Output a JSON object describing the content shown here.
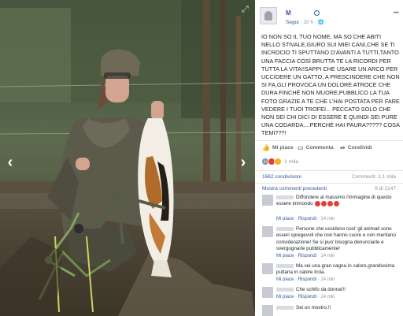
{
  "post": {
    "author": "M",
    "follow": "Segui",
    "time": "10 h",
    "text": "IO NON SO IL TUO NOME, MA SO CHE ABITI NELLO STIVALE,GIURO SUI MIEI CANI,CHE SE TI INCROCIO TI SPUTTANO D'AVANTI A TUTTI,TANTO UNA FACCIA COSÌ BRUTTA TE LA RICORDI PER TUTTA LA VITA!!SAPPI CHE USARE UN ARCO PER UCCIDERE UN GATTO, A PRESCINDERE CHE NON SI FA,GLI PROVOCA UN DOLORE ATROCE CHE DURA FINCHÈ NON MUORE,PUBBLICO LA TUA FOTO GRAZIE A TE CHE L'HAI POSTATA PER FARE VEDERE I TUOI TROFEI... PECCATO SOLO CHE NON SEI CHI DICI DI ESSERE E QUINDI SEI PURE UNA CODARDA....PERCHÈ HAI PAURA????? COSA TEMI???!"
  },
  "actions": {
    "like": "Mi piace",
    "comment": "Commenta",
    "share": "Condividi"
  },
  "reactions": {
    "count": "1 mila"
  },
  "stats": {
    "shares": "1662 condivisioni",
    "comments": "Commenti: 2,1 mila"
  },
  "more_comments": {
    "label": "Mostra commenti precedenti",
    "pager": "6 di 2147"
  },
  "comments": [
    {
      "text": "Diffondere al massimo l'immagine di questo essere immondo",
      "like": "Mi piace",
      "sep": " · ",
      "reply": "Rispondi",
      "time": " · 14 min"
    },
    {
      "text": "Persone che uccidono cosi' gli animali sono esseri spregevoli che non hanno cuore e non meritano considerazione! Se si puo' bisogna denunciarle e svergognarle pubblicamente!",
      "like": "Mi piace",
      "sep": " · ",
      "reply": "Rispondi",
      "time": " · 14 min"
    },
    {
      "text": "Ma sei una gran cagna in calore,grandissima puttana in calore troia.",
      "like": "Mi piace",
      "sep": " · ",
      "reply": "Rispondi",
      "time": " · 14 min"
    },
    {
      "text": "Che schifo da donna!!!",
      "like": "Mi piace",
      "sep": " · ",
      "reply": "Rispondi",
      "time": " · 14 min"
    },
    {
      "text": "Sei un mostro.!!"
    }
  ],
  "colors": {
    "link": "#365899",
    "muted": "#90949c",
    "text": "#1d2129",
    "like_blue": "#5890ff",
    "angry_red": "#e0403a",
    "love_red": "#f25268",
    "haha_yellow": "#f7b125"
  },
  "icons": [
    "expand-icon",
    "chevron-left-icon",
    "chevron-right-icon",
    "more-icon",
    "like-icon",
    "comment-icon",
    "share-icon"
  ]
}
